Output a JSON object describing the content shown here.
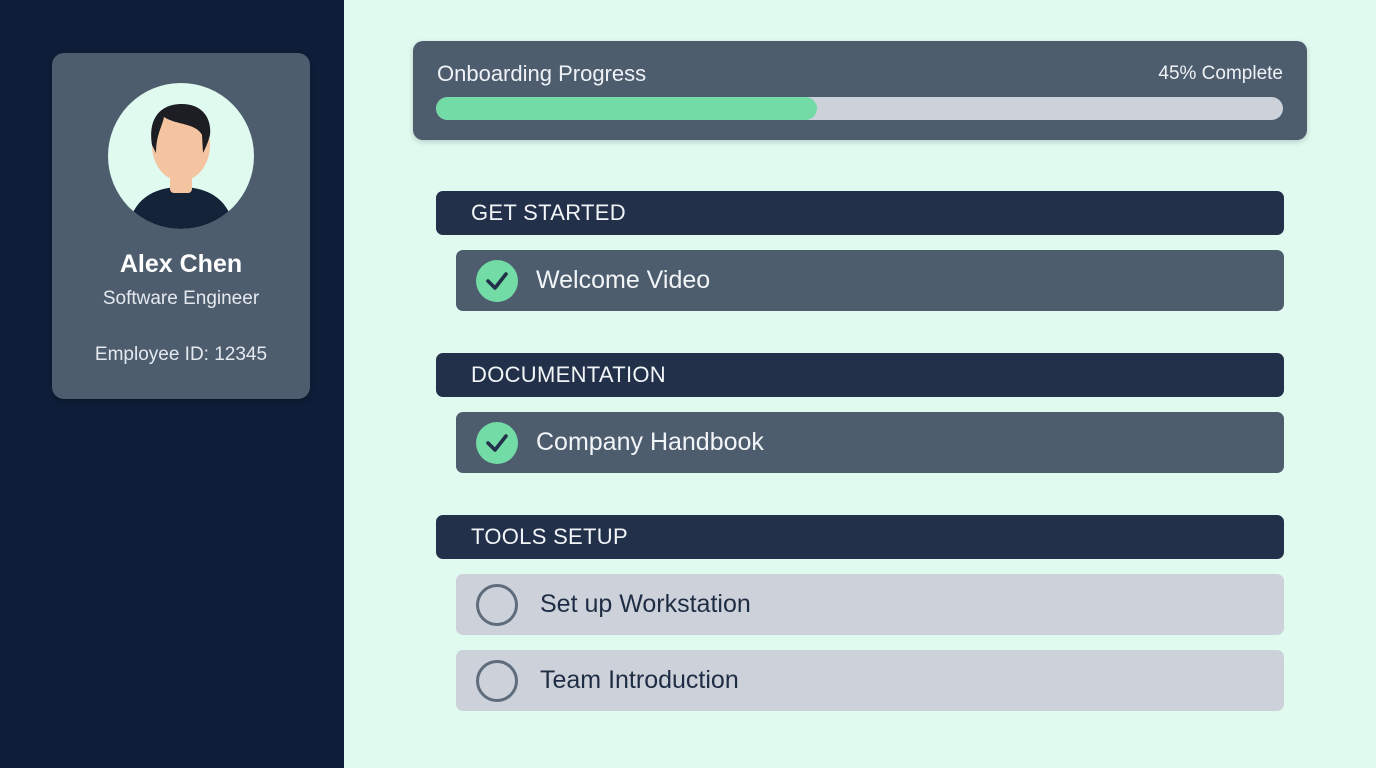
{
  "profile": {
    "name": "Alex Chen",
    "role": "Software Engineer",
    "employee_id": "Employee ID: 12345"
  },
  "progress": {
    "title": "Onboarding Progress",
    "status": "45% Complete",
    "percent": 45
  },
  "sections": [
    {
      "title": "GET STARTED",
      "tasks": [
        {
          "label": "Welcome Video",
          "completed": true
        }
      ]
    },
    {
      "title": "DOCUMENTATION",
      "tasks": [
        {
          "label": "Company Handbook",
          "completed": true
        }
      ]
    },
    {
      "title": "TOOLS SETUP",
      "tasks": [
        {
          "label": "Set up Workstation",
          "completed": false
        },
        {
          "label": "Team Introduction",
          "completed": false
        }
      ]
    }
  ],
  "colors": {
    "sidebar": "#0e1e38",
    "card": "#4e5d6e",
    "page_background": "#e0faf0",
    "accent_green": "#73dba6",
    "section_header": "#22304a",
    "todo_row": "#cdd2da"
  },
  "icons": {
    "avatar": "user-avatar-icon",
    "done": "check-circle-icon",
    "todo": "empty-circle-icon"
  }
}
